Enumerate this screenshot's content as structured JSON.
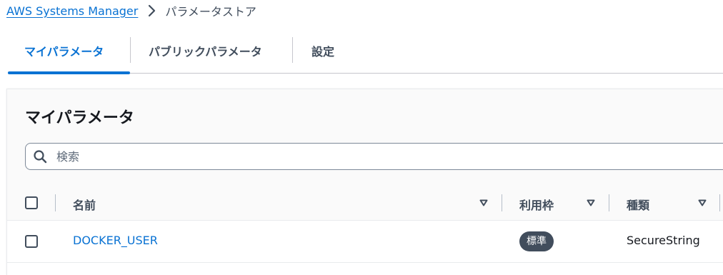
{
  "breadcrumb": {
    "root": "AWS Systems Manager",
    "current": "パラメータストア"
  },
  "tabs": [
    {
      "label": "マイパラメータ",
      "active": true
    },
    {
      "label": "パブリックパラメータ",
      "active": false
    },
    {
      "label": "設定",
      "active": false
    }
  ],
  "container": {
    "title": "マイパラメータ"
  },
  "search": {
    "placeholder": "検索",
    "value": ""
  },
  "table": {
    "columns": [
      {
        "label": "名前",
        "sortable": true
      },
      {
        "label": "利用枠",
        "sortable": true
      },
      {
        "label": "種類",
        "sortable": true
      }
    ],
    "rows": [
      {
        "name": "DOCKER_USER",
        "tier": "標準",
        "type": "SecureString",
        "checked": false
      }
    ]
  },
  "colors": {
    "link": "#0972d3",
    "text": "#16191f",
    "muted": "#414d5c",
    "badge_bg": "#414d5c",
    "header_bg": "#fafafa"
  },
  "icons": {
    "breadcrumb_separator": "chevron-right-icon",
    "search": "search-icon",
    "sort": "caret-down-icon"
  }
}
